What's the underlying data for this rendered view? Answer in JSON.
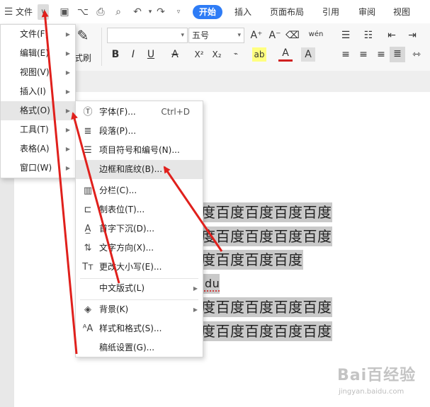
{
  "app": {
    "menu_label": "文件",
    "tabs": [
      "开始",
      "插入",
      "页面布局",
      "引用",
      "审阅",
      "视图"
    ]
  },
  "ribbon": {
    "font_name": "",
    "font_size": "五号",
    "format_painter": "式刷",
    "row2_icons": [
      "B",
      "I",
      "U",
      "A",
      "X²",
      "X₂",
      "ab",
      "A",
      "A"
    ],
    "size_up": "A⁺",
    "size_down": "A⁻",
    "phonetic": "wén"
  },
  "document": {
    "lines": [
      "度百度百度百度百度",
      "度百度百度百度百度",
      "度百度百度百度",
      "idu",
      "度百度百度百度百度",
      "度百度百度百度百度"
    ]
  },
  "main_menu": {
    "items": [
      {
        "label": "文件(F)",
        "has_sub": true
      },
      {
        "label": "编辑(E)",
        "has_sub": true
      },
      {
        "label": "视图(V)",
        "has_sub": true
      },
      {
        "label": "插入(I)",
        "has_sub": true
      },
      {
        "label": "格式(O)",
        "has_sub": true,
        "highlighted": true
      },
      {
        "label": "工具(T)",
        "has_sub": true
      },
      {
        "label": "表格(A)",
        "has_sub": true
      },
      {
        "label": "窗口(W)",
        "has_sub": true
      }
    ]
  },
  "format_menu": {
    "items": [
      {
        "label": "字体(F)...",
        "shortcut": "Ctrl+D",
        "icon": "font-circle-T-icon"
      },
      {
        "label": "段落(P)...",
        "icon": "paragraph-icon"
      },
      {
        "label": "项目符号和编号(N)...",
        "icon": "bullet-list-icon"
      },
      {
        "label": "边框和底纹(B)...",
        "highlighted": true,
        "icon": "border-shading-icon"
      },
      {
        "label": "分栏(C)...",
        "icon": "columns-icon"
      },
      {
        "label": "制表位(T)...",
        "icon": "tab-stop-icon"
      },
      {
        "label": "首字下沉(D)...",
        "icon": "drop-cap-icon"
      },
      {
        "label": "文字方向(X)...",
        "icon": "text-direction-icon"
      },
      {
        "label": "更改大小写(E)...",
        "icon": "change-case-icon"
      },
      {
        "label": "中文版式(L)",
        "has_sub": true
      },
      {
        "label": "背景(K)",
        "has_sub": true,
        "icon": "paint-bucket-icon"
      },
      {
        "label": "样式和格式(S)...",
        "icon": "styles-icon"
      },
      {
        "label": "稿纸设置(G)..."
      }
    ]
  },
  "watermark": {
    "brand": "Bai百经验",
    "url": "jingyan.baidu.com"
  },
  "colors": {
    "accent": "#2e7cf6",
    "arrow": "#e0201c",
    "selection": "#c9c9c9"
  }
}
